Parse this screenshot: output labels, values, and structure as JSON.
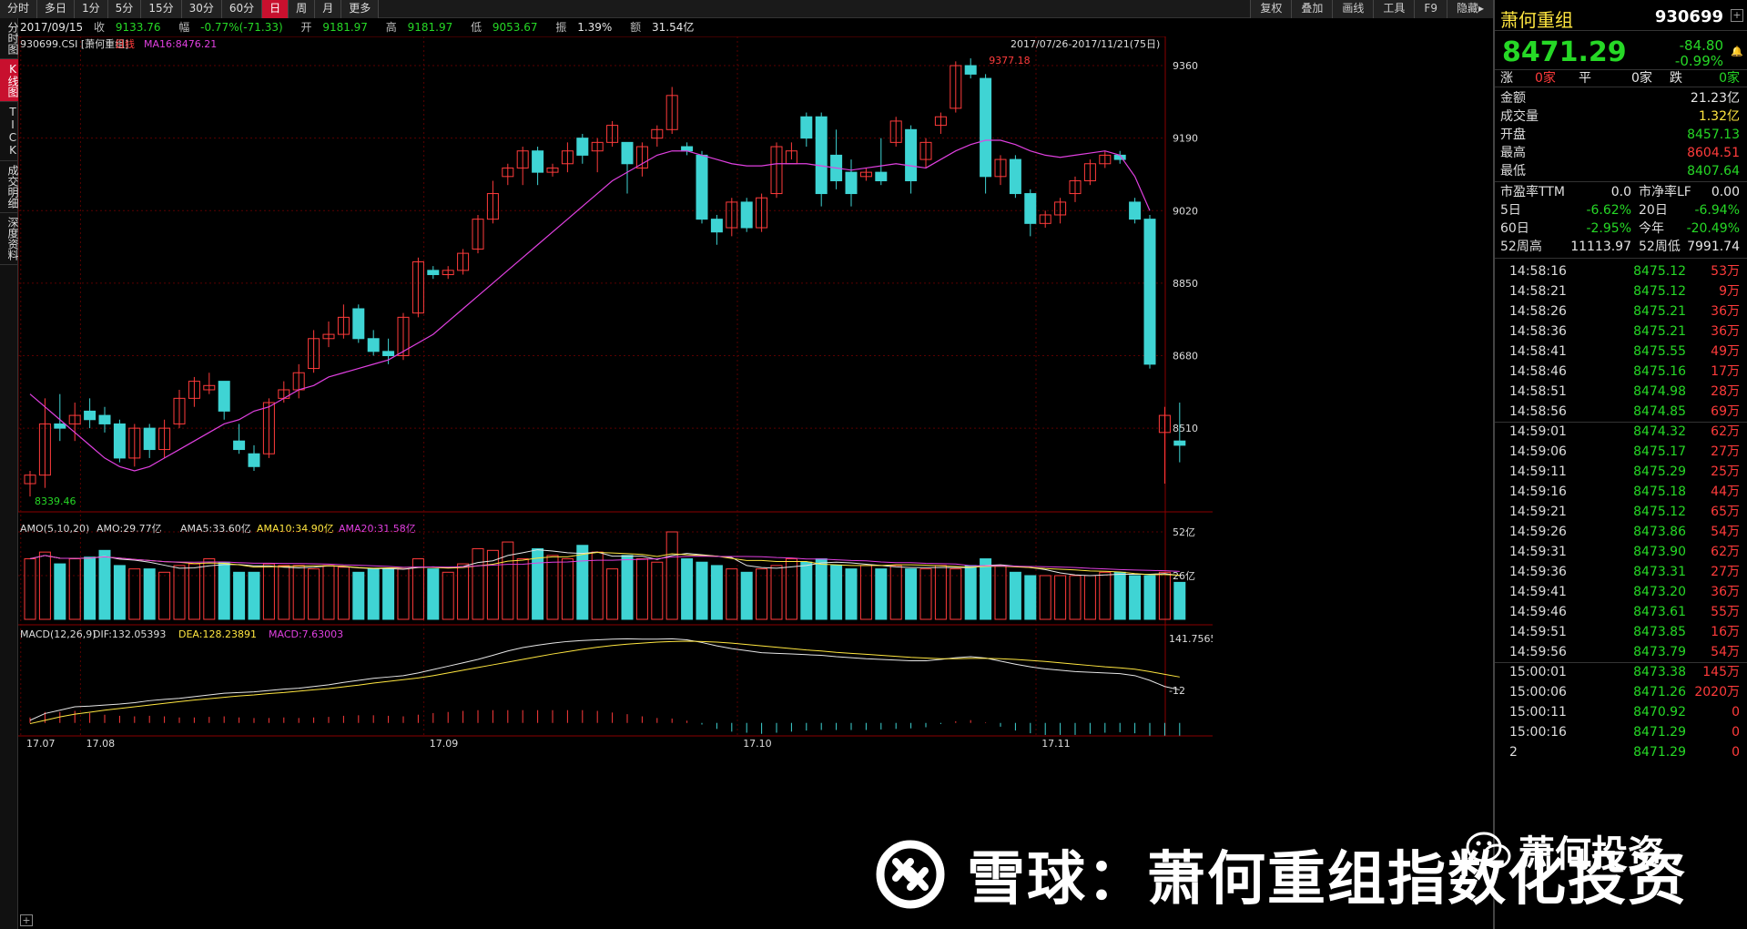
{
  "toolbar": {
    "left": [
      "分时",
      "多日",
      "1分",
      "5分",
      "15分",
      "30分",
      "60分",
      "日",
      "周",
      "月",
      "更多"
    ],
    "active": "日",
    "right": [
      "复权",
      "叠加",
      "画线",
      "工具",
      "F9",
      "隐藏▸"
    ]
  },
  "infobar": {
    "date": "2017/09/15",
    "close_label": "收",
    "close": "9133.76",
    "change_label": "幅",
    "change": "-0.77%(-71.33)",
    "open_label": "开",
    "open": "9181.97",
    "high_label": "高",
    "high": "9181.97",
    "low_label": "低",
    "low": "9053.67",
    "amp_label": "振",
    "amp": "1.39%",
    "amount_label": "额",
    "amount": "31.54亿"
  },
  "left_tabs": [
    "分时图",
    "K线图",
    "TICK",
    "成交明细",
    "深度资料"
  ],
  "left_tab_active": "K线图",
  "chart": {
    "title_code": "930699.CSI [萧何重组]",
    "title_period": "日线",
    "ma_label": "MA16:8476.21",
    "date_range": "2017/07/26-2017/11/21(75日)",
    "high_marker": "9377.18",
    "low_marker": "8339.46",
    "price_ticks": [
      "9360",
      "9190",
      "9020",
      "8850",
      "8680",
      "8510"
    ],
    "amo_label": "AMO(5,10,20)",
    "amo_value": "AMO:29.77亿",
    "ama5": "AMA5:33.60亿",
    "ama10": "AMA10:34.90亿",
    "ama20": "AMA20:31.58亿",
    "amo_ticks": [
      "52亿",
      "26亿"
    ],
    "macd_label": "MACD(12,26,9)",
    "dif": "DIF:132.05393",
    "dea": "DEA:128.23891",
    "macd": "MACD:7.63003",
    "macd_ticks": [
      "141.7565",
      "-12"
    ],
    "x_ticks": [
      "17.07",
      "17.08",
      "17.09",
      "17.10",
      "17.11"
    ],
    "colors": {
      "up": "#ff3b3b",
      "down": "#3fd4d4",
      "ma": "#e040e0",
      "grid": "#5a0000"
    }
  },
  "chart_data": {
    "type": "candlestick",
    "ylim": [
      8339.46,
      9377.18
    ],
    "candles": [
      [
        8380,
        8400,
        8350,
        8410
      ],
      [
        8400,
        8520,
        8370,
        8580
      ],
      [
        8520,
        8510,
        8480,
        8590
      ],
      [
        8520,
        8540,
        8480,
        8570
      ],
      [
        8550,
        8530,
        8510,
        8580
      ],
      [
        8540,
        8520,
        8500,
        8560
      ],
      [
        8520,
        8440,
        8430,
        8530
      ],
      [
        8440,
        8510,
        8420,
        8520
      ],
      [
        8510,
        8460,
        8440,
        8520
      ],
      [
        8460,
        8510,
        8440,
        8530
      ],
      [
        8520,
        8580,
        8510,
        8600
      ],
      [
        8580,
        8620,
        8560,
        8630
      ],
      [
        8600,
        8610,
        8590,
        8640
      ],
      [
        8620,
        8550,
        8530,
        8620
      ],
      [
        8480,
        8460,
        8450,
        8520
      ],
      [
        8450,
        8420,
        8410,
        8470
      ],
      [
        8450,
        8570,
        8440,
        8580
      ],
      [
        8580,
        8600,
        8570,
        8620
      ],
      [
        8600,
        8640,
        8580,
        8660
      ],
      [
        8650,
        8720,
        8640,
        8740
      ],
      [
        8720,
        8730,
        8700,
        8760
      ],
      [
        8730,
        8770,
        8720,
        8800
      ],
      [
        8790,
        8720,
        8710,
        8800
      ],
      [
        8720,
        8690,
        8680,
        8740
      ],
      [
        8690,
        8680,
        8660,
        8720
      ],
      [
        8680,
        8770,
        8670,
        8780
      ],
      [
        8780,
        8900,
        8770,
        8910
      ],
      [
        8880,
        8870,
        8860,
        8890
      ],
      [
        8870,
        8880,
        8860,
        8890
      ],
      [
        8880,
        8920,
        8870,
        8930
      ],
      [
        8930,
        9000,
        8920,
        9010
      ],
      [
        9000,
        9060,
        8990,
        9090
      ],
      [
        9100,
        9120,
        9080,
        9130
      ],
      [
        9120,
        9160,
        9080,
        9170
      ],
      [
        9160,
        9110,
        9080,
        9170
      ],
      [
        9110,
        9120,
        9100,
        9130
      ],
      [
        9130,
        9160,
        9110,
        9180
      ],
      [
        9190,
        9150,
        9130,
        9200
      ],
      [
        9160,
        9180,
        9110,
        9190
      ],
      [
        9180,
        9220,
        9170,
        9230
      ],
      [
        9180,
        9130,
        9060,
        9180
      ],
      [
        9120,
        9170,
        9100,
        9180
      ],
      [
        9190,
        9210,
        9170,
        9220
      ],
      [
        9210,
        9290,
        9200,
        9310
      ],
      [
        9170,
        9160,
        9150,
        9180
      ],
      [
        9150,
        9000,
        8990,
        9160
      ],
      [
        9000,
        8970,
        8940,
        9010
      ],
      [
        8980,
        9040,
        8960,
        9050
      ],
      [
        9040,
        8980,
        8970,
        9050
      ],
      [
        8980,
        9050,
        8970,
        9060
      ],
      [
        9060,
        9170,
        9050,
        9180
      ],
      [
        9130,
        9160,
        9140,
        9180
      ],
      [
        9240,
        9190,
        9170,
        9250
      ],
      [
        9240,
        9060,
        9030,
        9250
      ],
      [
        9150,
        9090,
        9070,
        9210
      ],
      [
        9110,
        9060,
        9030,
        9140
      ],
      [
        9100,
        9110,
        9090,
        9120
      ],
      [
        9110,
        9090,
        9080,
        9190
      ],
      [
        9180,
        9230,
        9170,
        9240
      ],
      [
        9210,
        9090,
        9060,
        9220
      ],
      [
        9140,
        9180,
        9120,
        9190
      ],
      [
        9220,
        9240,
        9200,
        9250
      ],
      [
        9260,
        9360,
        9250,
        9370
      ],
      [
        9360,
        9340,
        9330,
        9377
      ],
      [
        9330,
        9100,
        9060,
        9340
      ],
      [
        9100,
        9140,
        9080,
        9150
      ],
      [
        9140,
        9060,
        9050,
        9150
      ],
      [
        9060,
        8990,
        8960,
        9070
      ],
      [
        8990,
        9010,
        8980,
        9020
      ],
      [
        9010,
        9040,
        8990,
        9050
      ],
      [
        9060,
        9090,
        9040,
        9100
      ],
      [
        9090,
        9130,
        9080,
        9140
      ],
      [
        9130,
        9150,
        9120,
        9160
      ],
      [
        9150,
        9140,
        9130,
        9160
      ],
      [
        9040,
        9000,
        8990,
        9050
      ],
      [
        9000,
        8660,
        8650,
        9010
      ],
      [
        8500,
        8540,
        8380,
        8560
      ],
      [
        8480,
        8470,
        8430,
        8570
      ]
    ],
    "ma_series_label": "MA16",
    "ma": [
      8590,
      8560,
      8530,
      8500,
      8470,
      8440,
      8420,
      8410,
      8420,
      8440,
      8460,
      8480,
      8500,
      8520,
      8530,
      8550,
      8560,
      8580,
      8600,
      8610,
      8630,
      8640,
      8650,
      8660,
      8670,
      8690,
      8710,
      8730,
      8760,
      8790,
      8820,
      8850,
      8880,
      8910,
      8940,
      8970,
      9000,
      9030,
      9060,
      9090,
      9110,
      9130,
      9150,
      9160,
      9160,
      9150,
      9140,
      9130,
      9125,
      9125,
      9130,
      9130,
      9130,
      9125,
      9120,
      9115,
      9120,
      9125,
      9130,
      9125,
      9120,
      9140,
      9160,
      9175,
      9185,
      9185,
      9175,
      9160,
      9150,
      9145,
      9150,
      9155,
      9160,
      9150,
      9100,
      9020
    ],
    "amo": [
      36,
      40,
      33,
      36,
      37,
      41,
      32,
      30,
      30,
      28,
      32,
      33,
      36,
      34,
      28,
      28,
      33,
      32,
      32,
      30,
      32,
      31,
      28,
      30,
      30,
      30,
      36,
      30,
      28,
      33,
      42,
      41,
      46,
      36,
      42,
      38,
      36,
      44,
      40,
      30,
      38,
      36,
      34,
      52,
      36,
      34,
      32,
      30,
      28,
      30,
      32,
      36,
      34,
      36,
      32,
      30,
      32,
      30,
      32,
      30,
      30,
      32,
      30,
      32,
      36,
      32,
      28,
      26,
      26,
      26,
      26,
      26,
      28,
      28,
      26,
      26,
      28,
      22
    ],
    "dif": [
      -100,
      -80,
      -70,
      -60,
      -58,
      -55,
      -52,
      -48,
      -42,
      -38,
      -35,
      -30,
      -25,
      -20,
      -18,
      -16,
      -12,
      -8,
      -5,
      0,
      5,
      12,
      18,
      24,
      28,
      32,
      40,
      50,
      60,
      70,
      80,
      92,
      105,
      115,
      122,
      128,
      133,
      136,
      138,
      140,
      141,
      140,
      140,
      141,
      138,
      130,
      120,
      112,
      106,
      100,
      98,
      96,
      94,
      92,
      88,
      85,
      82,
      80,
      78,
      76,
      76,
      80,
      85,
      88,
      84,
      75,
      66,
      58,
      52,
      48,
      44,
      42,
      40,
      38,
      32,
      18,
      0,
      -10
    ],
    "dea": [
      -110,
      -100,
      -90,
      -82,
      -76,
      -70,
      -65,
      -60,
      -55,
      -50,
      -45,
      -40,
      -36,
      -32,
      -28,
      -25,
      -21,
      -18,
      -14,
      -10,
      -6,
      -1,
      4,
      10,
      15,
      20,
      25,
      32,
      40,
      48,
      56,
      64,
      72,
      80,
      88,
      96,
      103,
      110,
      116,
      121,
      125,
      128,
      131,
      133,
      134,
      133,
      131,
      128,
      124,
      120,
      116,
      112,
      108,
      105,
      101,
      98,
      95,
      92,
      89,
      86,
      84,
      82,
      82,
      83,
      83,
      82,
      80,
      77,
      74,
      70,
      66,
      62,
      58,
      55,
      51,
      44,
      36,
      28
    ]
  },
  "right_panel": {
    "name": "萧何重组",
    "code": "930699",
    "price": "8471.29",
    "change": "-84.80",
    "change_pct": "-0.99%",
    "up_label": "涨",
    "up_count": "0家",
    "flat_label": "平",
    "flat_count": "0家",
    "down_label": "跌",
    "down_count": "0家",
    "stats": [
      {
        "k": "金额",
        "v": "21.23亿",
        "c": "w"
      },
      {
        "k": "成交量",
        "v": "1.32亿",
        "c": "y"
      },
      {
        "k": "开盘",
        "v": "8457.13",
        "c": "g"
      },
      {
        "k": "最高",
        "v": "8604.51",
        "c": "r"
      },
      {
        "k": "最低",
        "v": "8407.64",
        "c": "g"
      }
    ],
    "stats2": [
      {
        "k1": "市盈率TTM",
        "v1": "0.0",
        "c1": "w",
        "k2": "市净率LF",
        "v2": "0.00",
        "c2": "w"
      },
      {
        "k1": "5日",
        "v1": "-6.62%",
        "c1": "g",
        "k2": "20日",
        "v2": "-6.94%",
        "c2": "g"
      },
      {
        "k1": "60日",
        "v1": "-2.95%",
        "c1": "g",
        "k2": "今年",
        "v2": "-20.49%",
        "c2": "g"
      },
      {
        "k1": "52周高",
        "v1": "11113.97",
        "c1": "w",
        "k2": "52周低",
        "v2": "7991.74",
        "c2": "w"
      }
    ],
    "ticks": [
      {
        "t": "14:58:16",
        "p": "8475.12",
        "v": "53万"
      },
      {
        "t": "14:58:21",
        "p": "8475.12",
        "v": "9万"
      },
      {
        "t": "14:58:26",
        "p": "8475.21",
        "v": "36万"
      },
      {
        "t": "14:58:36",
        "p": "8475.21",
        "v": "36万"
      },
      {
        "t": "14:58:41",
        "p": "8475.55",
        "v": "49万"
      },
      {
        "t": "14:58:46",
        "p": "8475.16",
        "v": "17万"
      },
      {
        "t": "14:58:51",
        "p": "8474.98",
        "v": "28万"
      },
      {
        "t": "14:58:56",
        "p": "8474.85",
        "v": "69万"
      },
      {
        "t": "14:59:01",
        "p": "8474.32",
        "v": "62万"
      },
      {
        "t": "14:59:06",
        "p": "8475.17",
        "v": "27万"
      },
      {
        "t": "14:59:11",
        "p": "8475.29",
        "v": "25万"
      },
      {
        "t": "14:59:16",
        "p": "8475.18",
        "v": "44万"
      },
      {
        "t": "14:59:21",
        "p": "8475.12",
        "v": "65万"
      },
      {
        "t": "14:59:26",
        "p": "8473.86",
        "v": "54万"
      },
      {
        "t": "14:59:31",
        "p": "8473.90",
        "v": "62万"
      },
      {
        "t": "14:59:36",
        "p": "8473.31",
        "v": "27万"
      },
      {
        "t": "14:59:41",
        "p": "8473.20",
        "v": "36万"
      },
      {
        "t": "14:59:46",
        "p": "8473.61",
        "v": "55万"
      },
      {
        "t": "14:59:51",
        "p": "8473.85",
        "v": "16万"
      },
      {
        "t": "14:59:56",
        "p": "8473.79",
        "v": "54万"
      },
      {
        "t": "15:00:01",
        "p": "8473.38",
        "v": "145万"
      },
      {
        "t": "15:00:06",
        "p": "8471.26",
        "v": "2020万"
      },
      {
        "t": "15:00:11",
        "p": "8470.92",
        "v": "0"
      },
      {
        "t": "15:00:16",
        "p": "8471.29",
        "v": "0"
      },
      {
        "t": "2",
        "p": "8471.29",
        "v": "0"
      }
    ]
  },
  "watermark": {
    "main": "雪球：萧何重组指数化投资",
    "sub": "萧何投资"
  }
}
